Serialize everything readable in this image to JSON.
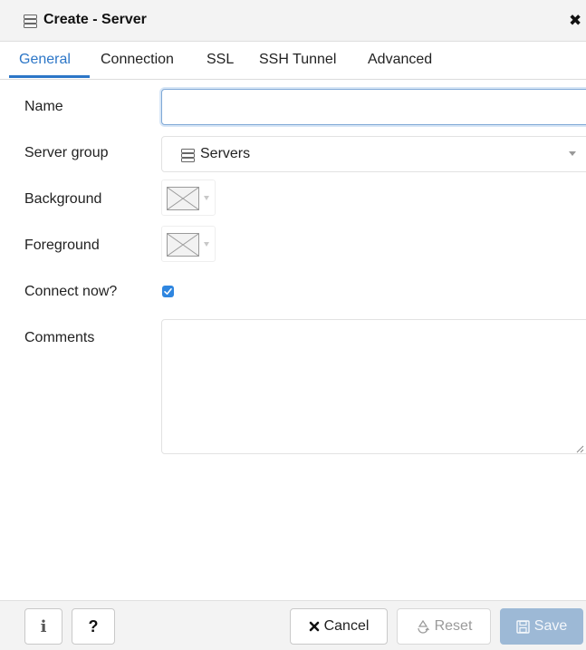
{
  "dialog": {
    "title": "Create - Server",
    "title_icon": "server-group-icon",
    "close_icon": "close-icon"
  },
  "tabs": [
    {
      "label": "General",
      "active": true
    },
    {
      "label": "Connection",
      "active": false
    },
    {
      "label": "SSL",
      "active": false
    },
    {
      "label": "SSH Tunnel",
      "active": false
    },
    {
      "label": "Advanced",
      "active": false
    }
  ],
  "form": {
    "name": {
      "label": "Name",
      "value": ""
    },
    "server_group": {
      "label": "Server group",
      "value": "Servers",
      "icon": "server-group-icon"
    },
    "background": {
      "label": "Background",
      "value_icon": "no-color-icon"
    },
    "foreground": {
      "label": "Foreground",
      "value_icon": "no-color-icon"
    },
    "connect_now": {
      "label": "Connect now?",
      "checked": true
    },
    "comments": {
      "label": "Comments",
      "value": ""
    }
  },
  "footer": {
    "info_glyph": "i",
    "help_glyph": "?",
    "cancel_label": "Cancel",
    "reset_label": "Reset",
    "save_label": "Save"
  },
  "colors": {
    "accent": "#2c76c7",
    "checkbox": "#2f86e0",
    "save_disabled_bg": "#9db9d6"
  }
}
